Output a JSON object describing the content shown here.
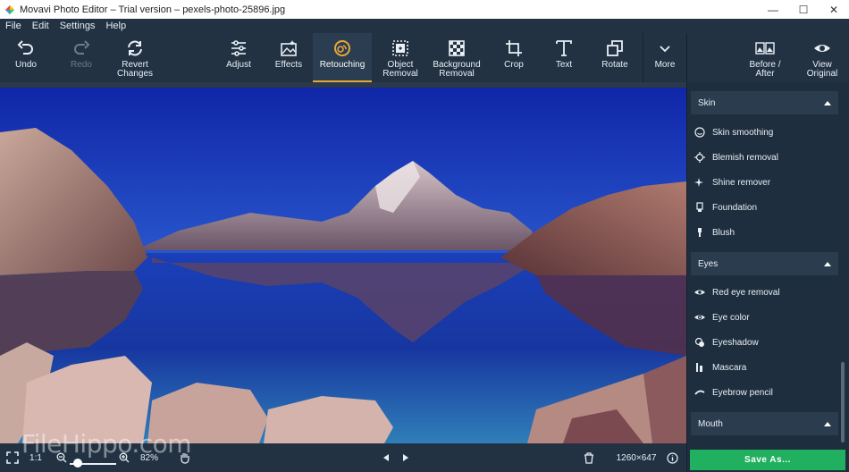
{
  "window": {
    "title": "Movavi Photo Editor – Trial version – pexels-photo-25896.jpg",
    "minimize": "—",
    "maximize": "☐",
    "close": "✕"
  },
  "menu": [
    "File",
    "Edit",
    "Settings",
    "Help"
  ],
  "toolbar": {
    "undo": "Undo",
    "redo": "Redo",
    "revert": "Revert\nChanges",
    "adjust": "Adjust",
    "effects": "Effects",
    "retouching": "Retouching",
    "object_removal": "Object\nRemoval",
    "background_removal": "Background\nRemoval",
    "crop": "Crop",
    "text": "Text",
    "rotate": "Rotate",
    "more": "More",
    "before_after": "Before /\nAfter",
    "view_original": "View\nOriginal"
  },
  "panel": {
    "skin": {
      "title": "Skin",
      "items": [
        "Skin smoothing",
        "Blemish removal",
        "Shine remover",
        "Foundation",
        "Blush"
      ]
    },
    "eyes": {
      "title": "Eyes",
      "items": [
        "Red eye removal",
        "Eye color",
        "Eyeshadow",
        "Mascara",
        "Eyebrow pencil"
      ]
    },
    "mouth": {
      "title": "Mouth"
    }
  },
  "bottom": {
    "ratio": "1:1",
    "zoom_percent": "82%",
    "zoom_level": 0.18,
    "dimensions": "1260×647",
    "save_label": "Save As..."
  },
  "watermark": "FileHippo.com",
  "colors": {
    "accent": "#e7a73a",
    "save_button": "#20b05f",
    "toolbar_bg": "#223243"
  }
}
